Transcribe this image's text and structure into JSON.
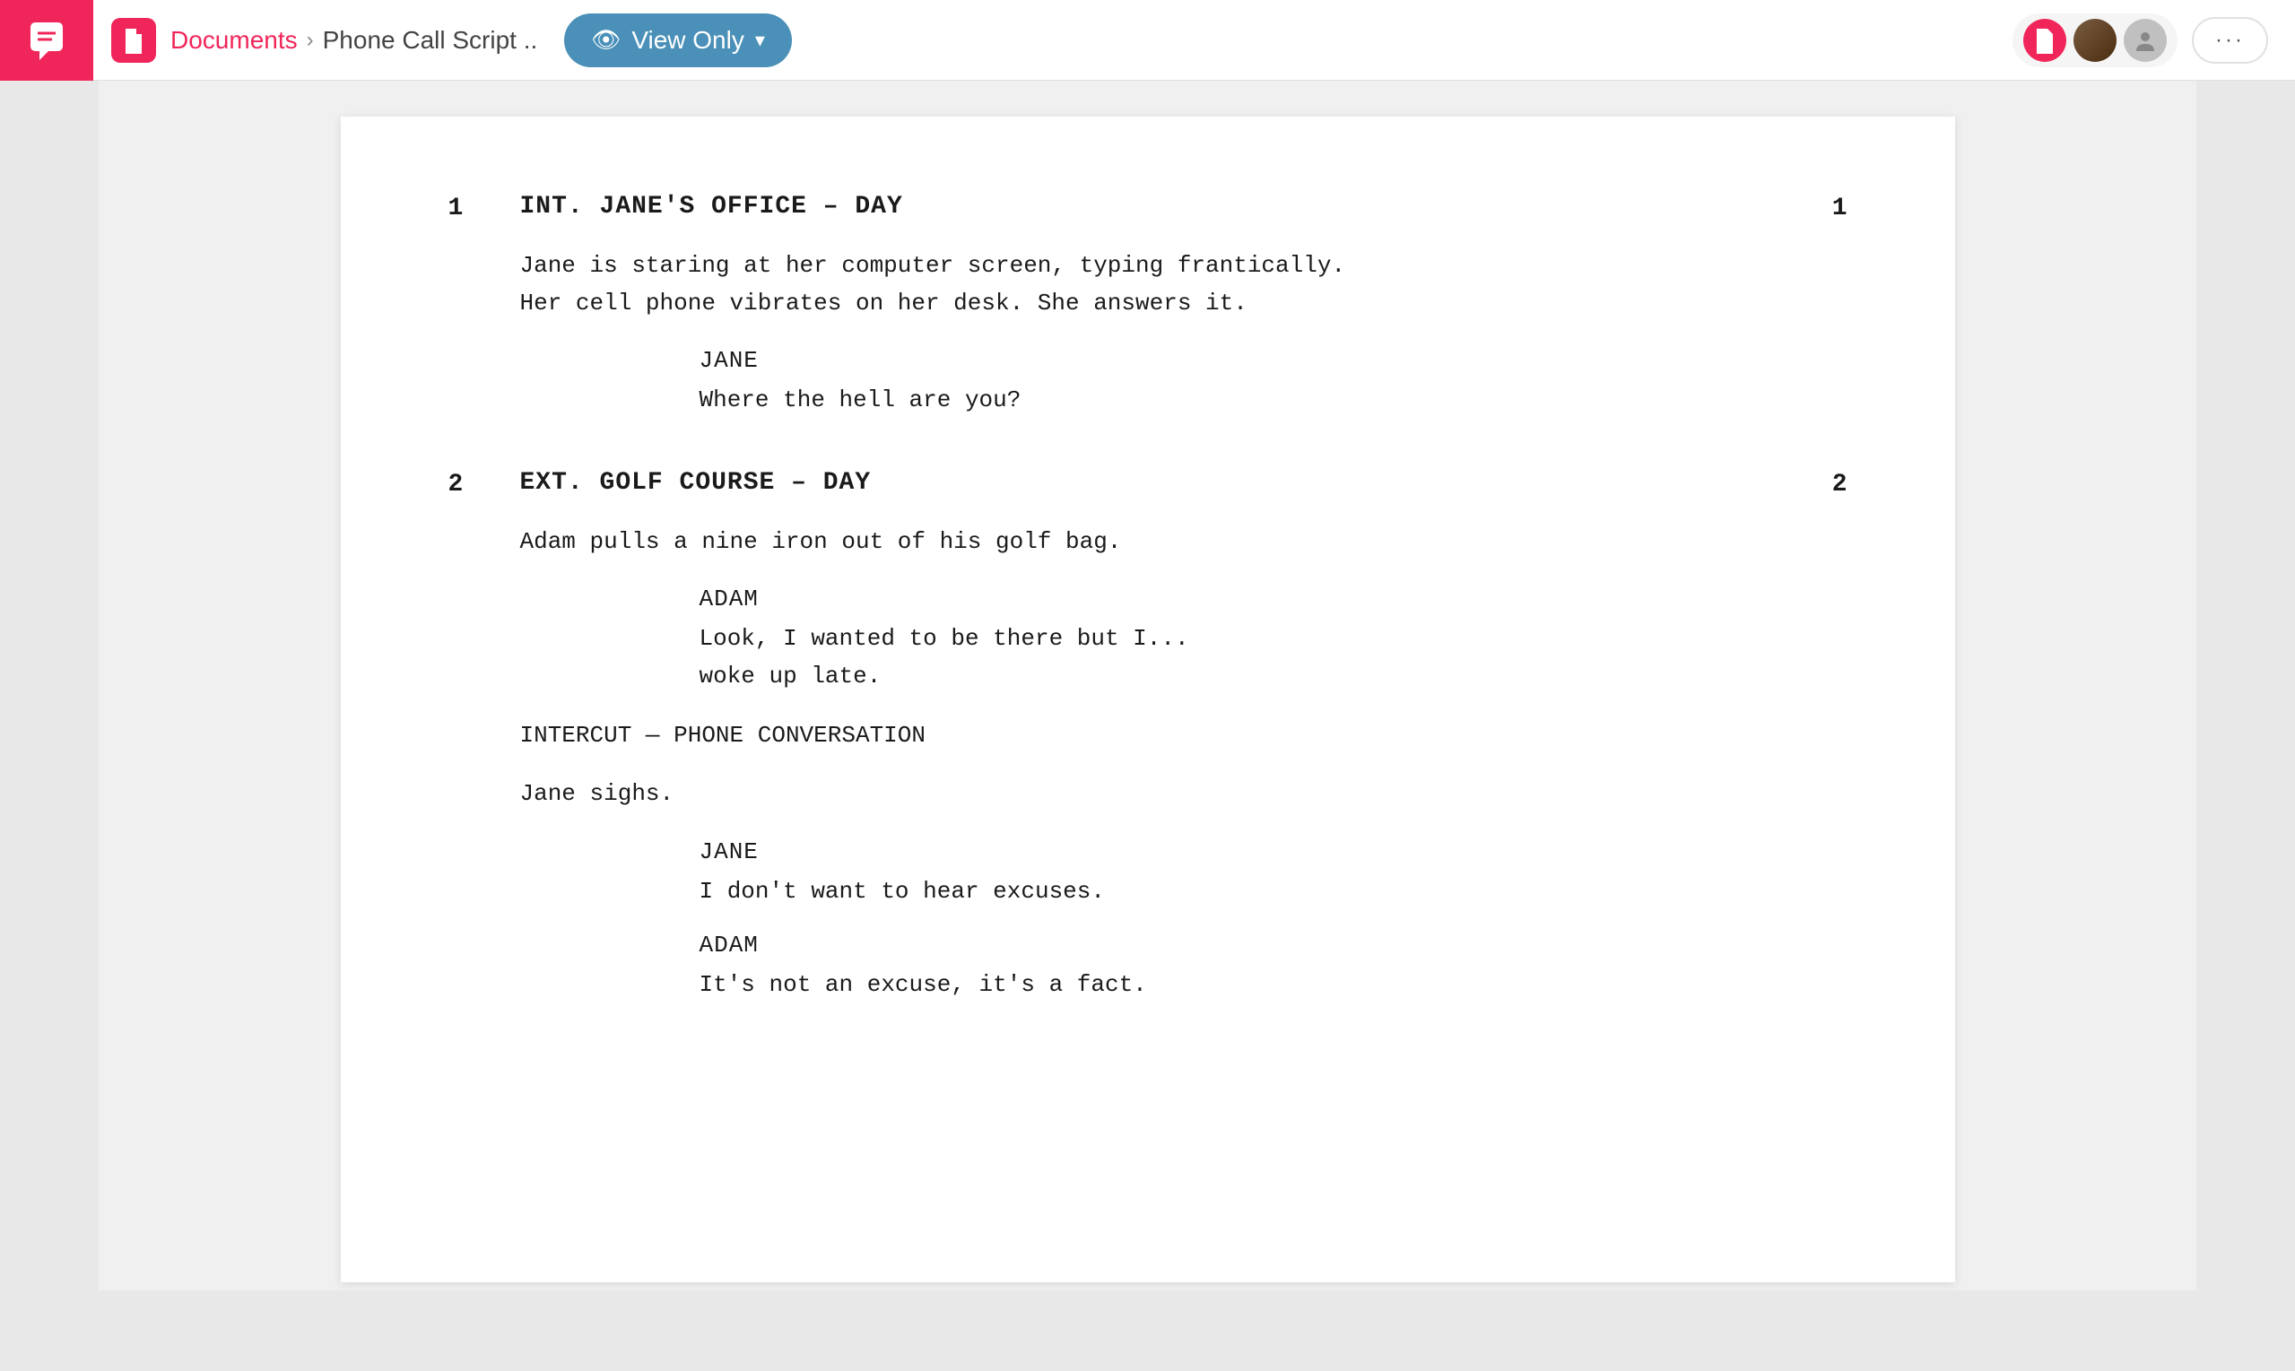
{
  "app": {
    "logo_alt": "Chat App Logo"
  },
  "navbar": {
    "doc_icon_alt": "document-icon",
    "breadcrumb_documents": "Documents",
    "breadcrumb_arrow": "›",
    "breadcrumb_current": "Phone Call Script ..",
    "view_only_label": "View Only",
    "more_label": "···"
  },
  "screenplay": {
    "scene1": {
      "number": "1",
      "header": "INT. JANE'S OFFICE – DAY",
      "action": "Jane is staring at her computer screen, typing frantically.\nHer cell phone vibrates on her desk. She answers it.",
      "dialogue": [
        {
          "character": "JANE",
          "text": "Where the hell are you?"
        }
      ]
    },
    "scene2": {
      "number": "2",
      "header": "EXT. GOLF COURSE – DAY",
      "action1": "Adam pulls a nine iron out of his golf bag.",
      "dialogue1": [
        {
          "character": "ADAM",
          "text": "Look, I wanted to be there but I...\nwoke up late."
        }
      ],
      "intercut": "INTERCUT — PHONE CONVERSATION",
      "action2": "Jane sighs.",
      "dialogue2": [
        {
          "character": "JANE",
          "text": "I don't want to hear excuses."
        },
        {
          "character": "ADAM",
          "text": "It's not an excuse, it's a fact."
        }
      ]
    }
  }
}
